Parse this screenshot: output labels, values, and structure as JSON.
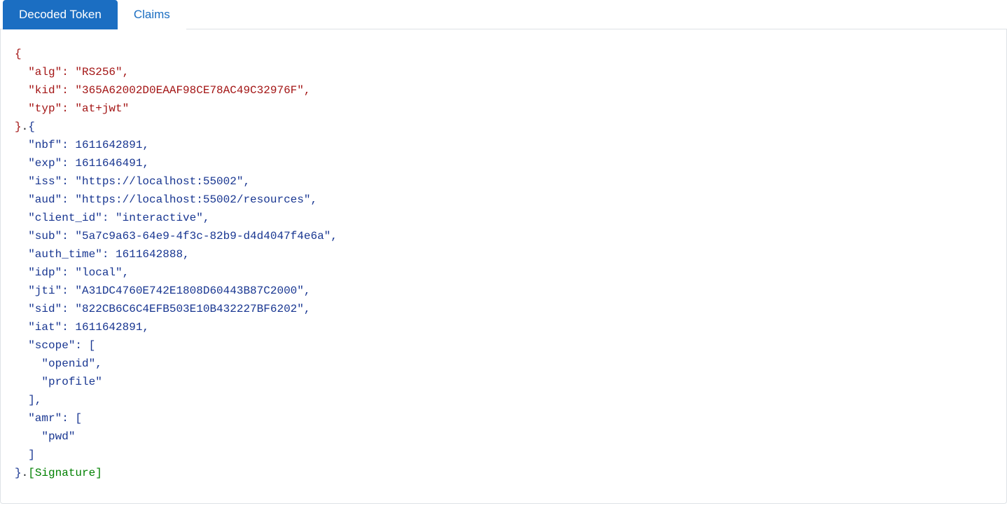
{
  "tabs": {
    "decoded": "Decoded Token",
    "claims": "Claims"
  },
  "signature_label": "[Signature]",
  "header_claims": {
    "alg": "RS256",
    "kid": "365A62002D0EAAF98CE78AC49C32976F",
    "typ": "at+jwt"
  },
  "payload_claims": {
    "nbf": 1611642891,
    "exp": 1611646491,
    "iss": "https://localhost:55002",
    "aud": "https://localhost:55002/resources",
    "client_id": "interactive",
    "sub": "5a7c9a63-64e9-4f3c-82b9-d4d4047f4e6a",
    "auth_time": 1611642888,
    "idp": "local",
    "jti": "A31DC4760E742E1808D60443B87C2000",
    "sid": "822CB6C6C4EFB503E10B432227BF6202",
    "iat": 1611642891,
    "scope": [
      "openid",
      "profile"
    ],
    "amr": [
      "pwd"
    ]
  }
}
